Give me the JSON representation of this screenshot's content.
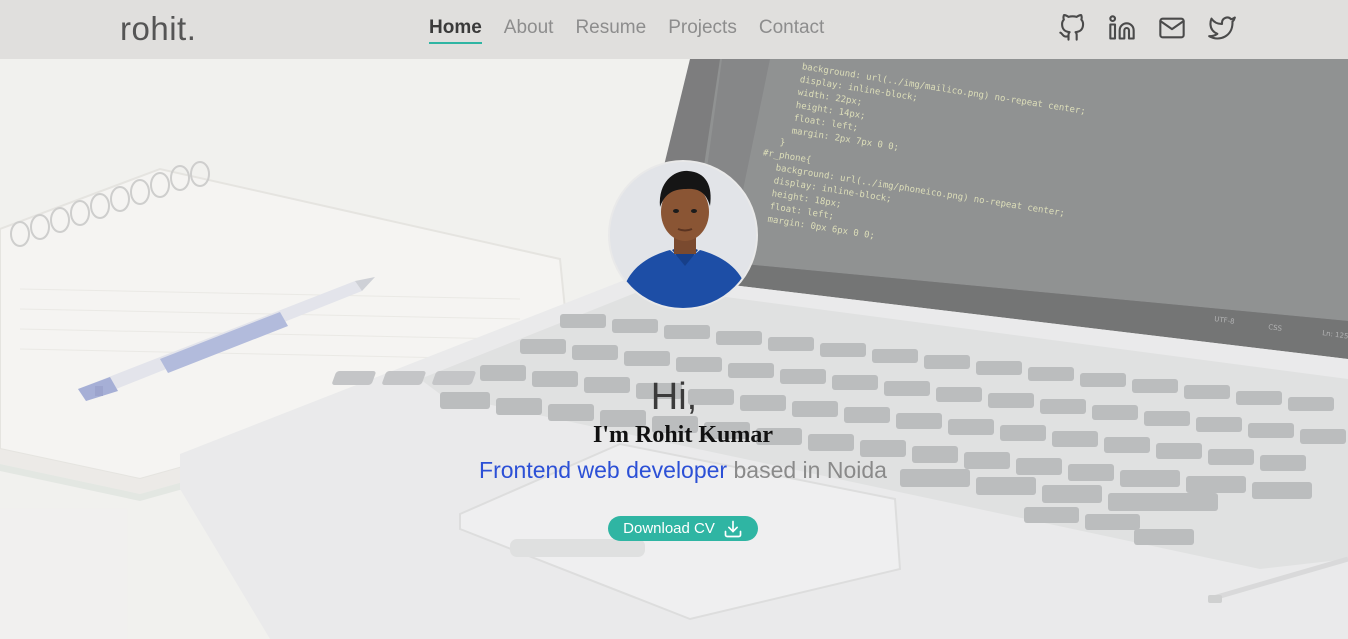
{
  "brand": "rohit.",
  "nav": {
    "items": [
      {
        "label": "Home",
        "active": true
      },
      {
        "label": "About",
        "active": false
      },
      {
        "label": "Resume",
        "active": false
      },
      {
        "label": "Projects",
        "active": false
      },
      {
        "label": "Contact",
        "active": false
      }
    ]
  },
  "social": [
    {
      "icon": "github-icon"
    },
    {
      "icon": "linkedin-icon"
    },
    {
      "icon": "mail-icon"
    },
    {
      "icon": "twitter-icon"
    }
  ],
  "hero": {
    "greeting": "Hi,",
    "name": "I'm Rohit Kumar",
    "role_accent": "Frontend web developer",
    "role_rest": " based in Noida",
    "cv_label": "Download CV",
    "cv_icon": "download-icon"
  },
  "background": {
    "code_lines": [
      "background: url(../img/mailico.png) no-repeat center;",
      "display: inline-block;",
      "width: 22px;",
      "height: 14px;",
      "float: left;",
      "margin: 2px 7px 0 0;",
      "}",
      "#r_phone{",
      "background: url(../img/phoneico.png) no-repeat center;",
      "display: inline-block;",
      "height: 18px;",
      "float: left;",
      "margin: 0px 6px 0 0;"
    ],
    "status": [
      "UTF-8",
      "CSS",
      "Ln: 125"
    ]
  },
  "colors": {
    "accent": "#2fb5a3",
    "link_blue": "#2c50d6",
    "navbar_bg": "#e0dfdd"
  }
}
